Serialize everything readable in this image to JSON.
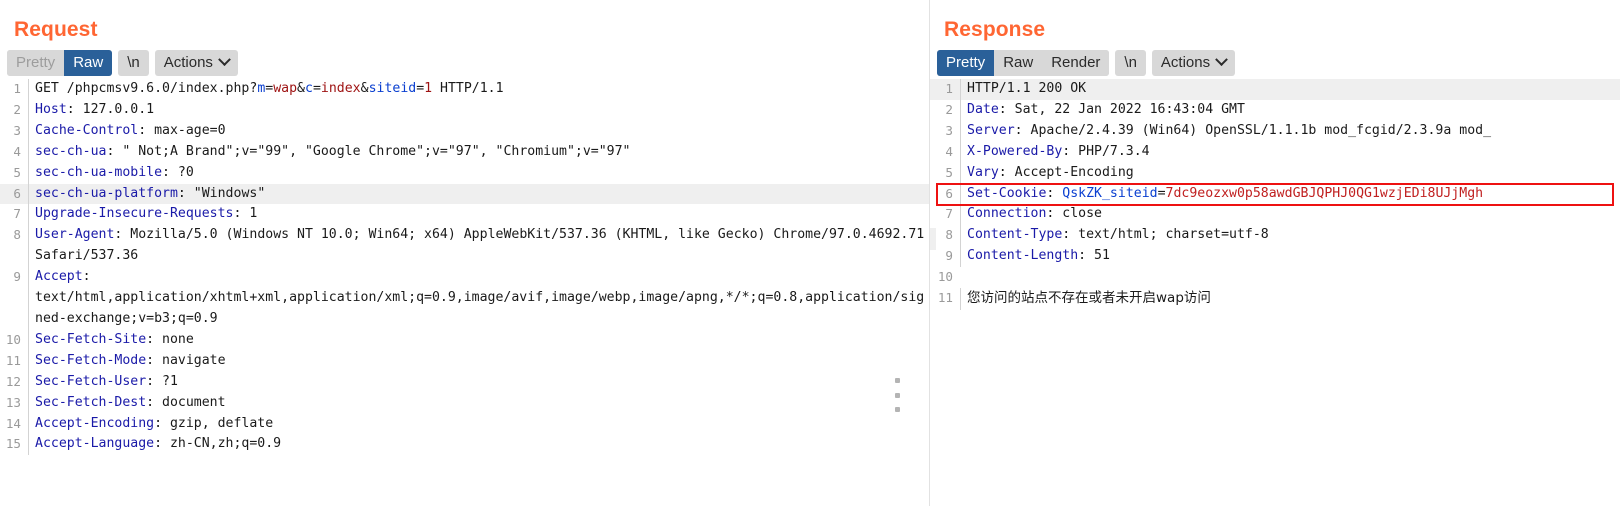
{
  "request": {
    "title": "Request",
    "tabs": [
      {
        "label": "Pretty",
        "selected": false,
        "dim": true
      },
      {
        "label": "Raw",
        "selected": true,
        "dim": false
      },
      {
        "label": "\\n",
        "selected": false,
        "dim": false
      }
    ],
    "actions_label": "Actions",
    "actions_icon": "chevron-down-icon",
    "lines": [
      {
        "n": "1",
        "highlight": false,
        "segments": [
          {
            "t": "GET /phpcmsv9.6.0/index.php?",
            "c": "val"
          },
          {
            "t": "m",
            "c": "kblue"
          },
          {
            "t": "=",
            "c": "val"
          },
          {
            "t": "wap",
            "c": "kred"
          },
          {
            "t": "&",
            "c": "val"
          },
          {
            "t": "c",
            "c": "kblue"
          },
          {
            "t": "=",
            "c": "val"
          },
          {
            "t": "index",
            "c": "kred"
          },
          {
            "t": "&",
            "c": "val"
          },
          {
            "t": "siteid",
            "c": "kblue"
          },
          {
            "t": "=",
            "c": "val"
          },
          {
            "t": "1",
            "c": "kred"
          },
          {
            "t": " HTTP/1.1",
            "c": "val"
          }
        ]
      },
      {
        "n": "2",
        "highlight": false,
        "segments": [
          {
            "t": "Host",
            "c": "hdr"
          },
          {
            "t": ": 127.0.0.1",
            "c": "val"
          }
        ]
      },
      {
        "n": "3",
        "highlight": false,
        "segments": [
          {
            "t": "Cache-Control",
            "c": "hdr"
          },
          {
            "t": ": max-age=0",
            "c": "val"
          }
        ]
      },
      {
        "n": "4",
        "highlight": false,
        "segments": [
          {
            "t": "sec-ch-ua",
            "c": "hdr"
          },
          {
            "t": ": \" Not;A Brand\";v=\"99\", \"Google Chrome\";v=\"97\", \"Chromium\";v=\"97\"",
            "c": "val"
          }
        ]
      },
      {
        "n": "5",
        "highlight": false,
        "segments": [
          {
            "t": "sec-ch-ua-mobile",
            "c": "hdr"
          },
          {
            "t": ": ?0",
            "c": "val"
          }
        ]
      },
      {
        "n": "6",
        "highlight": true,
        "segments": [
          {
            "t": "sec-ch-ua-platform",
            "c": "hdr"
          },
          {
            "t": ": \"Windows\"",
            "c": "val"
          }
        ]
      },
      {
        "n": "7",
        "highlight": false,
        "segments": [
          {
            "t": "Upgrade-Insecure-Requests",
            "c": "hdr"
          },
          {
            "t": ": 1",
            "c": "val"
          }
        ]
      },
      {
        "n": "8",
        "highlight": false,
        "wrap": true,
        "segments": [
          {
            "t": "User-Agent",
            "c": "hdr"
          },
          {
            "t": ": Mozilla/5.0 (Windows NT 10.0; Win64; x64) AppleWebKit/537.36 (KHTML, like Gecko) Chrome/97.0.4692.71 Safari/537.36",
            "c": "val"
          }
        ]
      },
      {
        "n": "9",
        "highlight": false,
        "wrap": true,
        "segments": [
          {
            "t": "Accept",
            "c": "hdr"
          },
          {
            "t": ":\ntext/html,application/xhtml+xml,application/xml;q=0.9,image/avif,image/webp,image/apng,*/*;q=0.8,application/signed-exchange;v=b3;q=0.9",
            "c": "val"
          }
        ]
      },
      {
        "n": "10",
        "highlight": false,
        "segments": [
          {
            "t": "Sec-Fetch-Site",
            "c": "hdr"
          },
          {
            "t": ": none",
            "c": "val"
          }
        ]
      },
      {
        "n": "11",
        "highlight": false,
        "segments": [
          {
            "t": "Sec-Fetch-Mode",
            "c": "hdr"
          },
          {
            "t": ": navigate",
            "c": "val"
          }
        ]
      },
      {
        "n": "12",
        "highlight": false,
        "segments": [
          {
            "t": "Sec-Fetch-User",
            "c": "hdr"
          },
          {
            "t": ": ?1",
            "c": "val"
          }
        ]
      },
      {
        "n": "13",
        "highlight": false,
        "segments": [
          {
            "t": "Sec-Fetch-Dest",
            "c": "hdr"
          },
          {
            "t": ": document",
            "c": "val"
          }
        ]
      },
      {
        "n": "14",
        "highlight": false,
        "segments": [
          {
            "t": "Accept-Encoding",
            "c": "hdr"
          },
          {
            "t": ": gzip, deflate",
            "c": "val"
          }
        ]
      },
      {
        "n": "15",
        "highlight": false,
        "segments": [
          {
            "t": "Accept-Language",
            "c": "hdr"
          },
          {
            "t": ": zh-CN,zh;q=0.9",
            "c": "val"
          }
        ]
      }
    ]
  },
  "response": {
    "title": "Response",
    "tabs": [
      {
        "label": "Pretty",
        "selected": true,
        "dim": false
      },
      {
        "label": "Raw",
        "selected": false,
        "dim": false
      },
      {
        "label": "Render",
        "selected": false,
        "dim": false
      },
      {
        "label": "\\n",
        "selected": false,
        "dim": false
      }
    ],
    "actions_label": "Actions",
    "actions_icon": "chevron-down-icon",
    "lines": [
      {
        "n": "1",
        "highlight": true,
        "segments": [
          {
            "t": "HTTP/1.1 200 OK",
            "c": "val"
          }
        ]
      },
      {
        "n": "2",
        "highlight": false,
        "segments": [
          {
            "t": "Date",
            "c": "hdr"
          },
          {
            "t": ": Sat, 22 Jan 2022 16:43:04 GMT",
            "c": "val"
          }
        ]
      },
      {
        "n": "3",
        "highlight": false,
        "segments": [
          {
            "t": "Server",
            "c": "hdr"
          },
          {
            "t": ": Apache/2.4.39 (Win64) OpenSSL/1.1.1b mod_fcgid/2.3.9a mod_",
            "c": "val"
          }
        ]
      },
      {
        "n": "4",
        "highlight": false,
        "segments": [
          {
            "t": "X-Powered-By",
            "c": "hdr"
          },
          {
            "t": ": PHP/7.3.4",
            "c": "val"
          }
        ]
      },
      {
        "n": "5",
        "highlight": false,
        "segments": [
          {
            "t": "Vary",
            "c": "hdr"
          },
          {
            "t": ": Accept-Encoding",
            "c": "val"
          }
        ]
      },
      {
        "n": "6",
        "highlight": false,
        "segments": [
          {
            "t": "Set-Cookie",
            "c": "hdr"
          },
          {
            "t": ": ",
            "c": "val"
          },
          {
            "t": "QskZK_siteid",
            "c": "kblue"
          },
          {
            "t": "=",
            "c": "val"
          },
          {
            "t": "7dc9eozxw0p58awdGBJQPHJ0QG1wzjEDi8UJjMgh",
            "c": "ckred"
          }
        ]
      },
      {
        "n": "7",
        "highlight": false,
        "segments": [
          {
            "t": "Connection",
            "c": "hdr"
          },
          {
            "t": ": close",
            "c": "val"
          }
        ]
      },
      {
        "n": "8",
        "highlight": false,
        "segments": [
          {
            "t": "Content-Type",
            "c": "hdr"
          },
          {
            "t": ": text/html; charset=utf-8",
            "c": "val"
          }
        ]
      },
      {
        "n": "9",
        "highlight": false,
        "segments": [
          {
            "t": "Content-Length",
            "c": "hdr"
          },
          {
            "t": ": 51",
            "c": "val"
          }
        ]
      },
      {
        "n": "10",
        "highlight": false,
        "segments": [
          {
            "t": "",
            "c": "val"
          }
        ]
      },
      {
        "n": "11",
        "highlight": false,
        "segments": [
          {
            "t": "您访问的站点不存在或者未开启wap访问",
            "c": "cjk"
          }
        ]
      }
    ],
    "annotation": {
      "type": "red-highlight-box",
      "target_line": "6",
      "color": "#ee1111"
    }
  },
  "splitter": {
    "grip_icon": "vertical-dots-grip-icon"
  },
  "colors": {
    "title": "#ff6633",
    "tab_selected_bg": "#2a6099",
    "tab_bg": "#d8d8d8",
    "header_name": "#1a1aa8",
    "annotation": "#ee1111"
  }
}
